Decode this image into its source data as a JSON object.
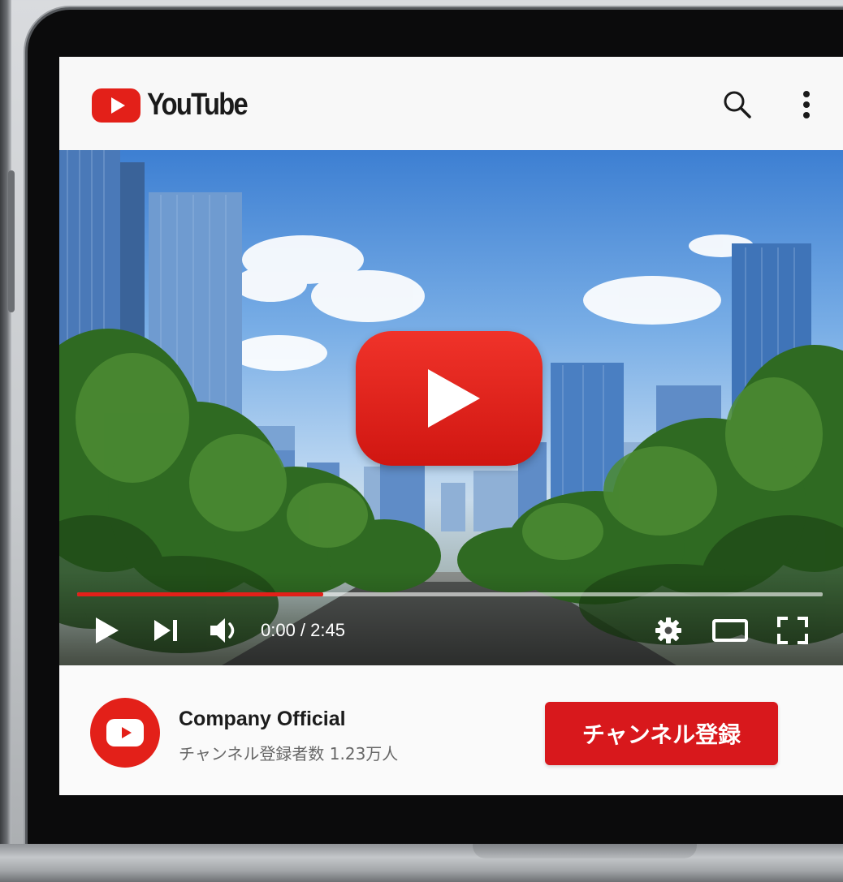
{
  "header": {
    "logo_text": "YouTube",
    "brand_color": "#e32019",
    "icons": [
      "search-icon",
      "more-vert-icon"
    ]
  },
  "player": {
    "time_display": "0:00 / 2:45",
    "current_time": "0:00",
    "duration": "2:45",
    "progress_fraction": 0.33,
    "controls": [
      "play-icon",
      "next-icon",
      "volume-icon",
      "settings-icon",
      "theater-mode-icon",
      "fullscreen-icon"
    ]
  },
  "channel": {
    "name": "Company Official",
    "subscribers": "チャンネル登録者数 1.23万人",
    "subscribe_label": "チャンネル登録"
  }
}
